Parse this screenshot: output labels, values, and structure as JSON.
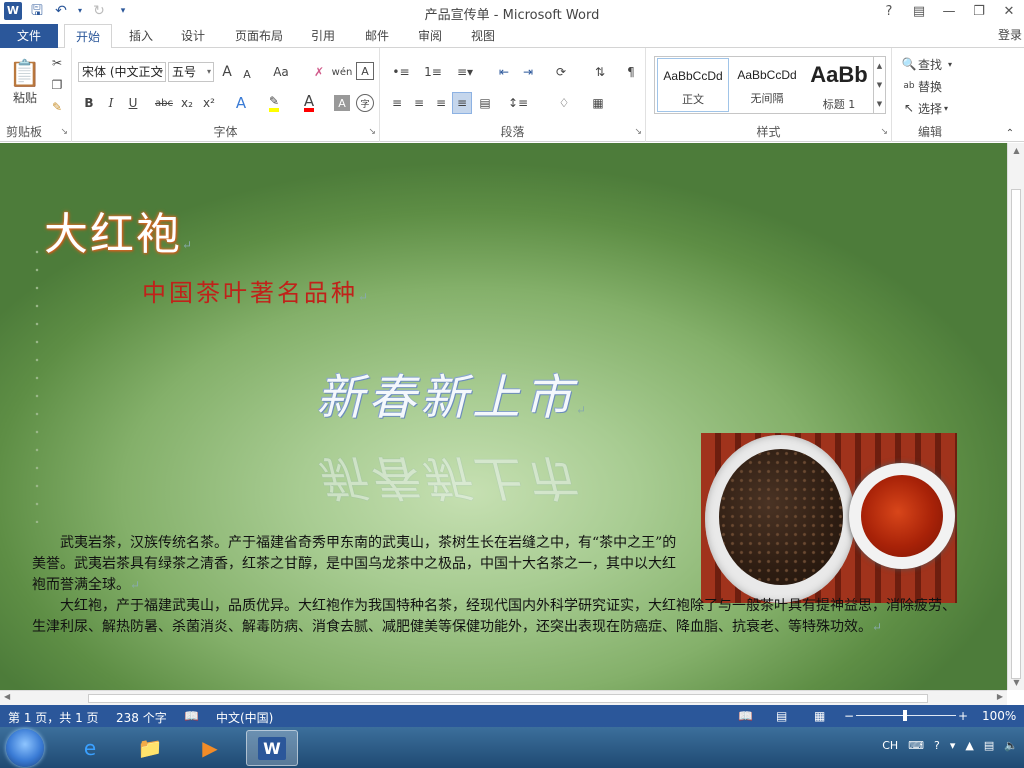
{
  "window": {
    "title": "产品宣传单 - Microsoft Word"
  },
  "qat": {
    "app_icon": "W"
  },
  "tabs": [
    "文件",
    "开始",
    "插入",
    "设计",
    "页面布局",
    "引用",
    "邮件",
    "审阅",
    "视图"
  ],
  "login": "登录",
  "clipboard": {
    "paste": "粘贴",
    "label": "剪贴板"
  },
  "font": {
    "name": "宋体 (中文正文",
    "size": "五号",
    "label": "字体",
    "bold": "B",
    "italic": "I",
    "underline": "U",
    "strike": "abc",
    "sub": "x₂",
    "sup": "x²",
    "grow": "A",
    "shrink": "A",
    "case": "Aa",
    "phonetic": "wén",
    "border": "A"
  },
  "paragraph": {
    "label": "段落"
  },
  "styles": {
    "label": "样式",
    "items": [
      {
        "preview": "AaBbCcDd",
        "name": "正文"
      },
      {
        "preview": "AaBbCcDd",
        "name": "无间隔"
      },
      {
        "preview": "AaBb",
        "name": "标题 1"
      }
    ]
  },
  "editing": {
    "find": "查找",
    "replace": "替换",
    "select": "选择",
    "label": "编辑"
  },
  "document": {
    "title": "大红袍",
    "subtitle": "中国茶叶著名品种",
    "slogan": "新春新上市",
    "para1": "武夷岩茶，汉族传统名茶。产于福建省奇秀甲东南的武夷山，茶树生长在岩缝之中，有“茶中之王”的美誉。武夷岩茶具有绿茶之清香，红茶之甘醇，是中国乌龙茶中之极品，中国十大名茶之一，其中以大红袍而誉满全球。",
    "para2": "大红袍，产于福建武夷山，品质优异。大红袍作为我国特种名茶，经现代国内外科学研究证实，大红袍除了与一般茶叶具有提神益思，消除疲劳、生津利尿、解热防暑、杀菌消炎、解毒防病、消食去腻、减肥健美等保健功能外，还突出表现在防癌症、降血脂、抗衰老、等特殊功效。"
  },
  "status": {
    "page": "第 1 页，共 1 页",
    "words": "238 个字",
    "lang": "中文(中国)",
    "zoom": "100%",
    "zoom_minus": "−",
    "zoom_plus": "+"
  },
  "tray": {
    "ime": "CH"
  },
  "colors": {
    "accent": "#2b579a",
    "highlight": "#ffff00",
    "font_color": "#ff0000"
  }
}
